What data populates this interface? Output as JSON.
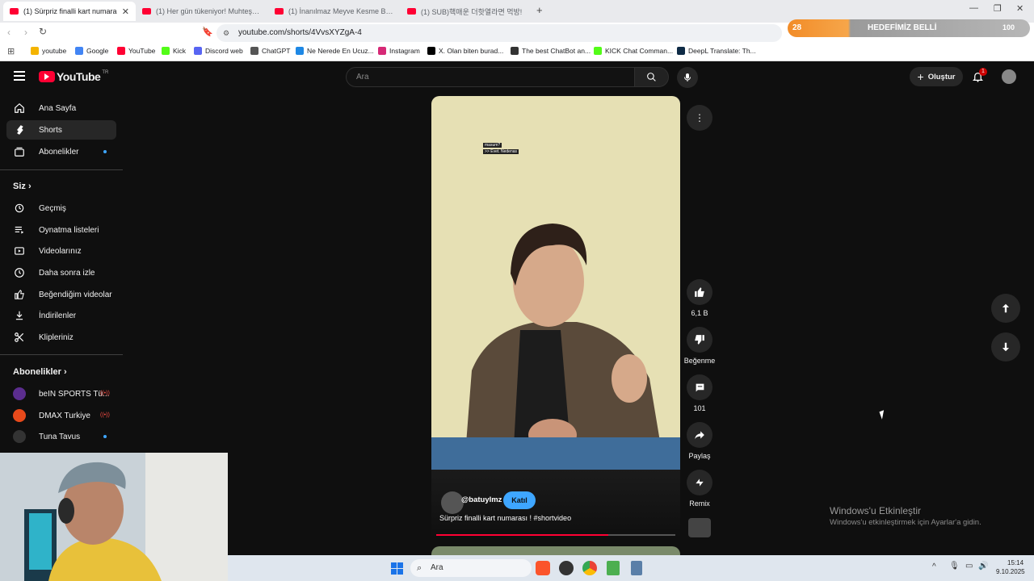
{
  "browser": {
    "tabs": [
      {
        "title": "(1) Sürpriz finalli kart numara",
        "active": true
      },
      {
        "title": "(1) Her gün tükeniyor! Muhteşem de"
      },
      {
        "title": "(1) İnanılmaz Meyve Kesme Becerileri"
      },
      {
        "title": "(1) SUB)핵매운 더핫열라면 먹방!"
      }
    ],
    "url": "youtube.com/shorts/4VvsXYZgA-4",
    "bookmarks": [
      {
        "label": "youtube",
        "color": "#f4b400"
      },
      {
        "label": "Google",
        "color": "#4285f4"
      },
      {
        "label": "YouTube",
        "color": "#ff0033"
      },
      {
        "label": "Kick",
        "color": "#53fc18"
      },
      {
        "label": "Discord web",
        "color": "#5865f2"
      },
      {
        "label": "ChatGPT",
        "color": "#555555"
      },
      {
        "label": "Ne Nerede En Ucuz...",
        "color": "#1e88e5"
      },
      {
        "label": "Instagram",
        "color": "#d62976"
      },
      {
        "label": "X. Olan biten burad...",
        "color": "#000000"
      },
      {
        "label": "The best ChatBot an...",
        "color": "#333333"
      },
      {
        "label": "KICK Chat Comman...",
        "color": "#53fc18"
      },
      {
        "label": "DeepL Translate: Th...",
        "color": "#0f2b46"
      }
    ],
    "overlay": {
      "count": "28",
      "text": "HEDEFİMİZ BELLİ",
      "goal": "100"
    }
  },
  "youtube": {
    "logo": "YouTube",
    "region": "TR",
    "search_placeholder": "Ara",
    "create_label": "Oluştur",
    "notification_count": "1",
    "sidebar": {
      "main": [
        {
          "label": "Ana Sayfa",
          "icon": "home-icon"
        },
        {
          "label": "Shorts",
          "icon": "shorts-icon"
        },
        {
          "label": "Abonelikler",
          "icon": "subscriptions-icon"
        }
      ],
      "you_title": "Siz",
      "you": [
        {
          "label": "Geçmiş",
          "icon": "history-icon"
        },
        {
          "label": "Oynatma listeleri",
          "icon": "playlists-icon"
        },
        {
          "label": "Videolarınız",
          "icon": "your-videos-icon"
        },
        {
          "label": "Daha sonra izle",
          "icon": "watch-later-icon"
        },
        {
          "label": "Beğendiğim videolar",
          "icon": "liked-icon"
        },
        {
          "label": "İndirilenler",
          "icon": "downloads-icon"
        },
        {
          "label": "Klipleriniz",
          "icon": "clips-icon"
        }
      ],
      "subs_title": "Abonelikler",
      "subs": [
        {
          "label": "beIN SPORTS Tü...",
          "color": "#5b2d8e"
        },
        {
          "label": "DMAX Turkiye",
          "color": "#e84a1b"
        },
        {
          "label": "Tuna Tavus",
          "color": "#333333"
        }
      ]
    },
    "short": {
      "channel": "@batuylmz",
      "join_label": "Katıl",
      "title": "Sürpriz finalli kart numarası ! #shortvideo",
      "caption_line1": "masum?",
      "caption_line2": ">> Evet. Nedenas",
      "progress": 0.72,
      "actions": {
        "likes": "6,1 B",
        "dislike": "Beğenme",
        "comments": "101",
        "share": "Paylaş",
        "remix": "Remix"
      }
    }
  },
  "windows": {
    "activation_title": "Windows'u Etkinleştir",
    "activation_sub": "Windows'u etkinleştirmek için Ayarlar'a gidin.",
    "taskbar_search": "Ara",
    "time": "15:14",
    "date": "9.10.2025"
  }
}
